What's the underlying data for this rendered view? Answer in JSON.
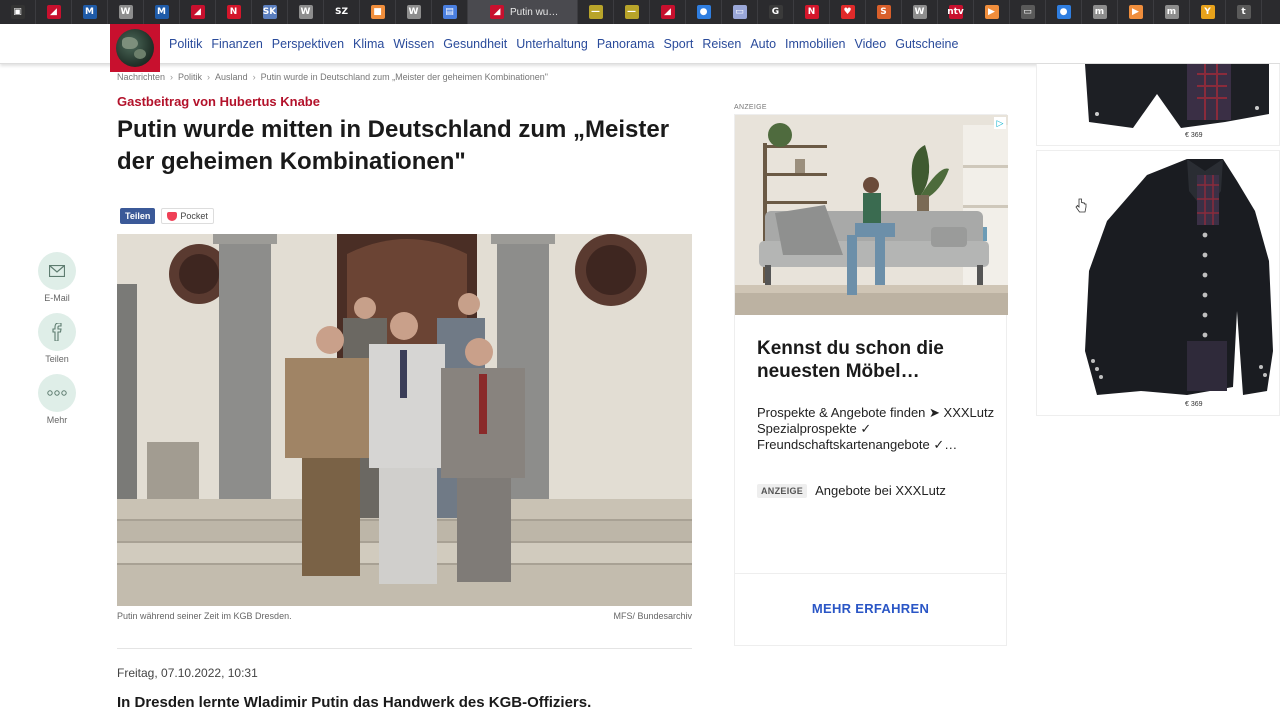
{
  "browser": {
    "active_tab_title": "Putin wu…",
    "tab_favicons": [
      {
        "glyph": "▣",
        "color": "#333333"
      },
      {
        "glyph": "◢",
        "color": "#c8102e"
      },
      {
        "glyph": "M",
        "color": "#1f5ba8"
      },
      {
        "glyph": "W",
        "color": "#8d8d8d"
      },
      {
        "glyph": "M",
        "color": "#1f5ba8"
      },
      {
        "glyph": "◢",
        "color": "#c8102e"
      },
      {
        "glyph": "N",
        "color": "#d4162b"
      },
      {
        "glyph": "SK",
        "color": "#5b7fbf"
      },
      {
        "glyph": "W",
        "color": "#8d8d8d"
      },
      {
        "glyph": "SZ",
        "color": "#2b2b2e"
      },
      {
        "glyph": "■",
        "color": "#f08e3c"
      },
      {
        "glyph": "W",
        "color": "#8d8d8d"
      },
      {
        "glyph": "▤",
        "color": "#4a7fe0"
      }
    ],
    "tab_favicons_right": [
      {
        "glyph": "—",
        "color": "#b8a42a"
      },
      {
        "glyph": "—",
        "color": "#b8a42a"
      },
      {
        "glyph": "◢",
        "color": "#c8102e"
      },
      {
        "glyph": "●",
        "color": "#2f7ee0"
      },
      {
        "glyph": "▭",
        "color": "#9aa7d8"
      },
      {
        "glyph": "G",
        "color": "#3a3a3a"
      },
      {
        "glyph": "N",
        "color": "#d4162b"
      },
      {
        "glyph": "♥",
        "color": "#e02a2a"
      },
      {
        "glyph": "S",
        "color": "#d95f2a"
      },
      {
        "glyph": "W",
        "color": "#8d8d8d"
      },
      {
        "glyph": "ntv",
        "color": "#c8102e"
      },
      {
        "glyph": "▶",
        "color": "#f08e3c"
      },
      {
        "glyph": "▭",
        "color": "#5a5a5a"
      },
      {
        "glyph": "●",
        "color": "#2f7ee0"
      },
      {
        "glyph": "m",
        "color": "#8d8d8d"
      },
      {
        "glyph": "▶",
        "color": "#f08e3c"
      },
      {
        "glyph": "m",
        "color": "#8d8d8d"
      },
      {
        "glyph": "Y",
        "color": "#e8a21b"
      },
      {
        "glyph": "t",
        "color": "#5a5a5a"
      }
    ]
  },
  "nav": {
    "items": [
      "Politik",
      "Finanzen",
      "Perspektiven",
      "Klima",
      "Wissen",
      "Gesundheit",
      "Unterhaltung",
      "Panorama",
      "Sport",
      "Reisen",
      "Auto",
      "Immobilien",
      "Video",
      "Gutscheine"
    ]
  },
  "breadcrumb": [
    "Nachrichten",
    "Politik",
    "Ausland",
    "Putin wurde in Deutschland zum „Meister der geheimen Kombinationen\""
  ],
  "article": {
    "kicker": "Gastbeitrag von Hubertus Knabe",
    "headline": "Putin wurde mitten in Deutschland zum „Meister der geheimen Kombinationen\"",
    "share_label": "Teilen",
    "pocket_label": "Pocket",
    "caption": "Putin während seiner Zeit im KGB Dresden.",
    "credit": "MFS/ Bundesarchiv",
    "dateline": "Freitag, 07.10.2022, 10:31",
    "lead": "In Dresden lernte Wladimir Putin das Handwerk des KGB-Offiziers."
  },
  "rail": {
    "email": "E-Mail",
    "share": "Teilen",
    "more": "Mehr"
  },
  "ad": {
    "label": "ANZEIGE",
    "title": "Kennst du schon die neuesten Möbel…",
    "text": "Prospekte & Angebote finden ➤ XXXLutz Spezialprospekte ✓ Freundschaftskartenangebote ✓…",
    "badge": "ANZEIGE",
    "brand": "Angebote bei XXXLutz",
    "cta": "MEHR ERFAHREN"
  },
  "jacket_ads": {
    "price_1": "€ 369",
    "price_2": "€ 369"
  },
  "colors": {
    "brand_red": "#c8102e",
    "nav_blue": "#2a4b9b",
    "kicker_red": "#b3122b",
    "cta_blue": "#2a56c6"
  }
}
